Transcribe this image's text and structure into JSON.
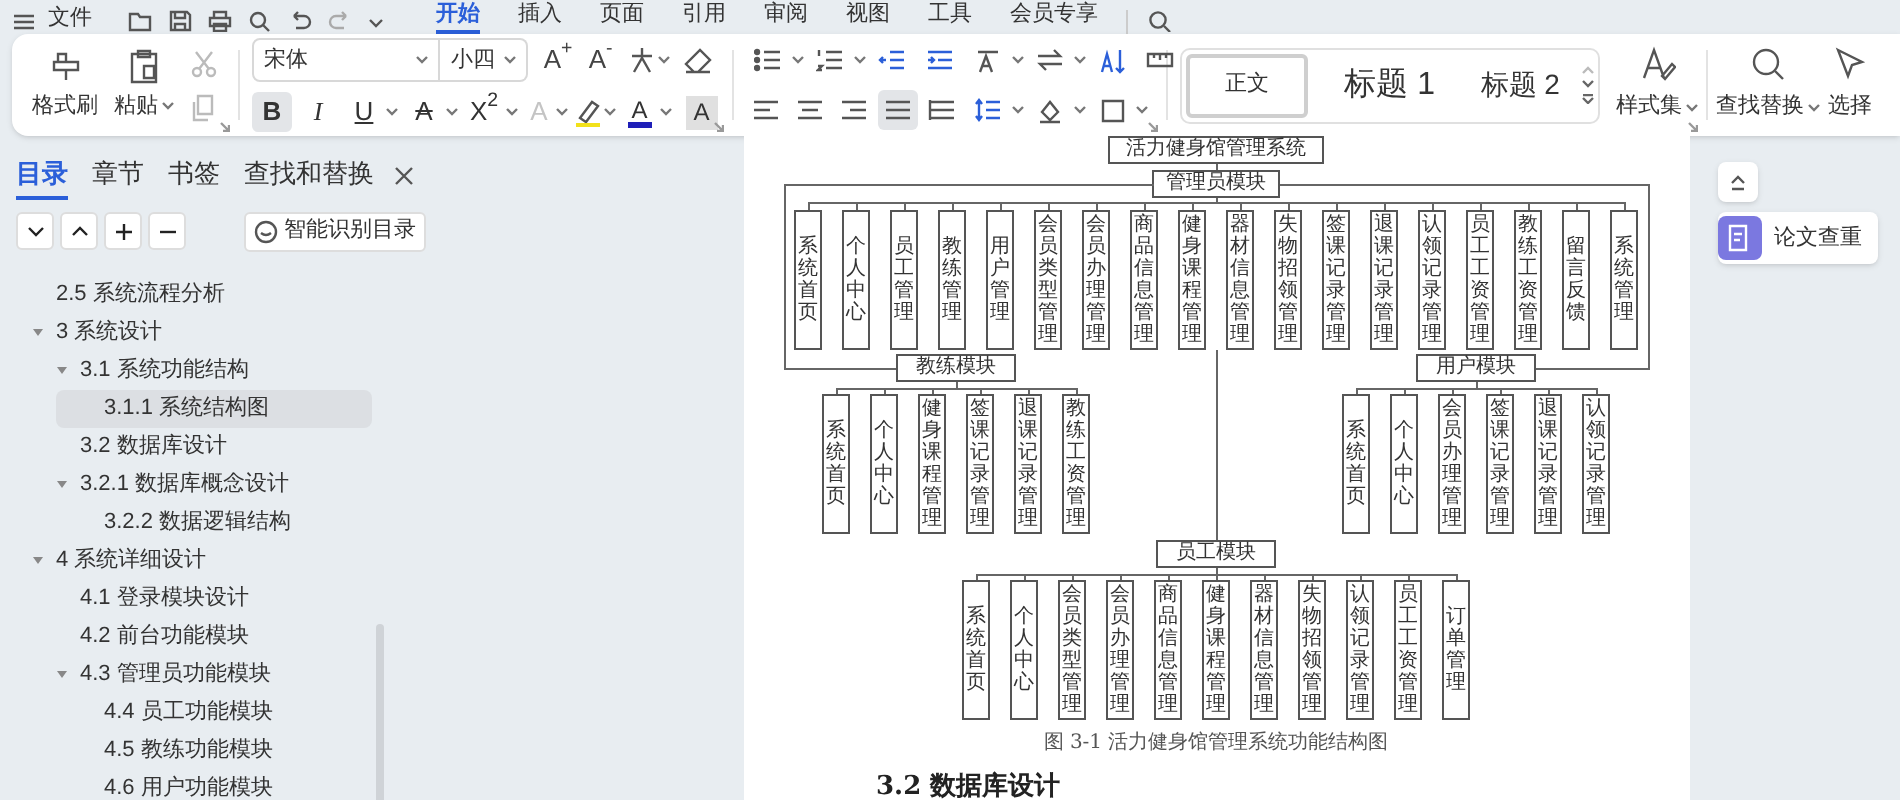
{
  "title_bar": {
    "file_menu": "文件",
    "tabs": [
      {
        "label": "开始",
        "selected": true
      },
      {
        "label": "插入",
        "selected": false
      },
      {
        "label": "页面",
        "selected": false
      },
      {
        "label": "引用",
        "selected": false
      },
      {
        "label": "审阅",
        "selected": false
      },
      {
        "label": "视图",
        "selected": false
      },
      {
        "label": "工具",
        "selected": false
      },
      {
        "label": "会员专享",
        "selected": false
      }
    ]
  },
  "ribbon": {
    "clipboard": {
      "format_painter": "格式刷",
      "paste": "粘贴"
    },
    "font": {
      "name": "宋体",
      "size": "小四",
      "grow": "A$^{+}$",
      "shrink": "A$^{-}$",
      "toggles": [
        {
          "kind": "bold",
          "label": "B",
          "on": true
        },
        {
          "kind": "italic",
          "label": "I",
          "on": false
        },
        {
          "kind": "underline",
          "label": "U",
          "on": false
        },
        {
          "kind": "strike",
          "label": "A",
          "on": false
        },
        {
          "kind": "superscript",
          "label": "X$^{2}$",
          "on": false
        }
      ],
      "effect": "A",
      "color_button": "A",
      "shading": "A"
    },
    "paragraph": {
      "alignments": [
        {
          "selected": false
        },
        {
          "selected": false
        },
        {
          "selected": false
        },
        {
          "selected": true
        },
        {
          "selected": false
        }
      ]
    },
    "styles": [
      {
        "kind": "body",
        "label": "正文",
        "selected": true
      },
      {
        "kind": "heading1",
        "label": "标题 1",
        "selected": false
      },
      {
        "kind": "heading2",
        "label": "标题 2",
        "selected": false
      }
    ],
    "style_set": "样式集",
    "find_replace": "查找替换",
    "select": "选择"
  },
  "sidebar": {
    "tabs": [
      {
        "label": "目录",
        "selected": true
      },
      {
        "label": "章节",
        "selected": false
      },
      {
        "label": "书签",
        "selected": false
      },
      {
        "label": "查找和替换",
        "selected": false
      }
    ],
    "smart_toc_button": "智能识别目录",
    "toc": [
      {
        "label": "2.5 系统流程分析",
        "selected": false
      },
      {
        "label": "3 系统设计",
        "expanded": true,
        "selected": false,
        "children": [
          {
            "label": "3.1 系统功能结构",
            "expanded": true,
            "selected": false,
            "children": [
              {
                "label": "3.1.1 系统结构图",
                "selected": true
              }
            ]
          },
          {
            "label": "3.2 数据库设计",
            "selected": false
          },
          {
            "label": "3.2.1 数据库概念设计",
            "expanded": true,
            "selected": false,
            "children": [
              {
                "label": "3.2.2 数据逻辑结构",
                "selected": false
              }
            ]
          }
        ]
      },
      {
        "label": "4 系统详细设计",
        "expanded": true,
        "selected": false,
        "children": [
          {
            "label": "4.1 登录模块设计",
            "selected": false
          },
          {
            "label": "4.2 前台功能模块",
            "selected": false
          },
          {
            "label": "4.3 管理员功能模块",
            "expanded": true,
            "selected": false,
            "children": [
              {
                "label": "4.4 员工功能模块",
                "selected": false
              },
              {
                "label": "4.5 教练功能模块",
                "selected": false
              },
              {
                "label": "4.6 用户功能模块",
                "selected": false
              }
            ]
          }
        ]
      }
    ]
  },
  "document": {
    "diagram": {
      "label": "活力健身馆管理系统",
      "children": [
        {
          "label": "管理员模块",
          "children": [
            "系统首页",
            "个人中心",
            "员工管理",
            "教练管理",
            "用户管理",
            "会员类型管理",
            "会员办理管理",
            "商品信息管理",
            "健身课程管理",
            "器材信息管理",
            "失物招领管理",
            "签课记录管理",
            "退课记录管理",
            "认领记录管理",
            "员工工资管理",
            "教练工资管理",
            "留言反馈",
            "系统管理"
          ]
        },
        {
          "label": "教练模块",
          "children": [
            "系统首页",
            "个人中心",
            "健身课程管理",
            "签课记录管理",
            "退课记录管理",
            "教练工资管理"
          ]
        },
        {
          "label": "用户模块",
          "children": [
            "系统首页",
            "个人中心",
            "会员办理管理",
            "签课记录管理",
            "退课记录管理",
            "认领记录管理"
          ]
        },
        {
          "label": "员工模块",
          "children": [
            "系统首页",
            "个人中心",
            "会员类型管理",
            "会员办理管理",
            "商品信息管理",
            "健身课程管理",
            "器材信息管理",
            "失物招领管理",
            "认领记录管理",
            "员工工资管理",
            "订单管理"
          ]
        }
      ]
    },
    "caption": "图 3-1 活力健身馆管理系统功能结构图",
    "heading": "3.2 数据库设计"
  },
  "side_panel": {
    "paper_check": "论文查重"
  }
}
